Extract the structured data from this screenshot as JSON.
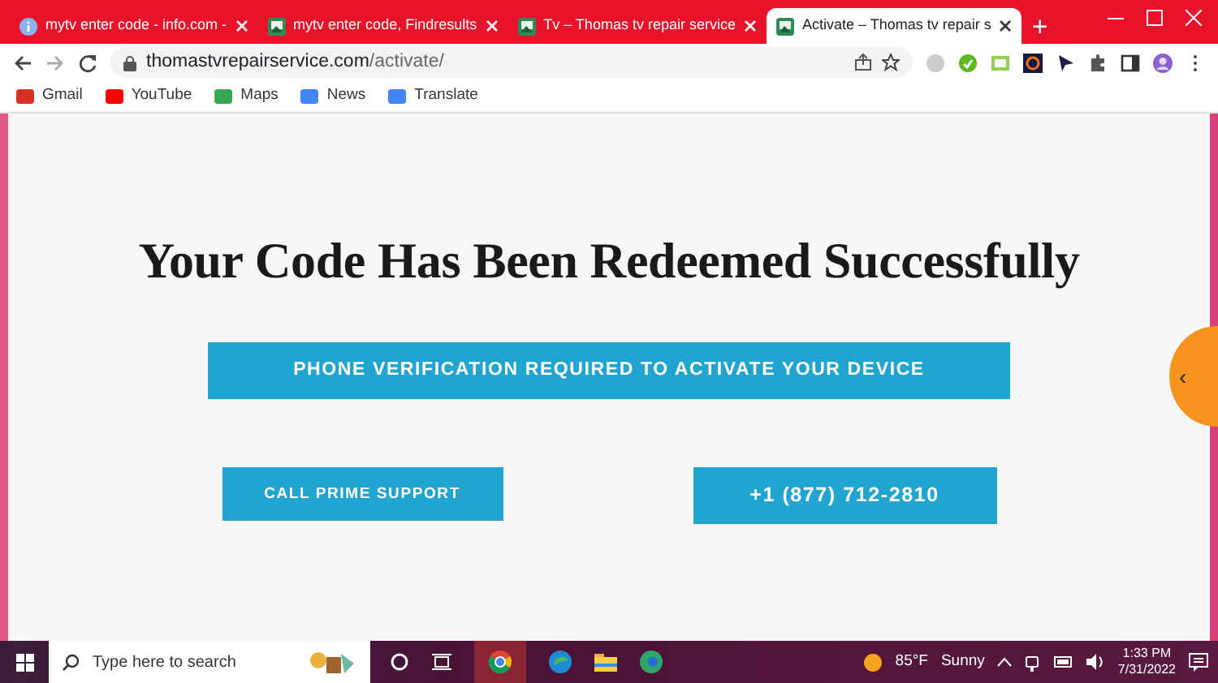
{
  "tabs": [
    {
      "title": "mytv enter code - info.com -",
      "selected": false
    },
    {
      "title": "mytv enter code, Findresults",
      "selected": false
    },
    {
      "title": "Tv – Thomas tv repair service",
      "selected": false
    },
    {
      "title": "Activate – Thomas tv repair s",
      "selected": true
    }
  ],
  "new_tab": "+",
  "address": {
    "host": "thomastvrepairservice.com",
    "path": "/activate/"
  },
  "bookmarks": [
    {
      "label": "Gmail",
      "color": "#d93025"
    },
    {
      "label": "YouTube",
      "color": "#ff0000"
    },
    {
      "label": "Maps",
      "color": "#34a853"
    },
    {
      "label": "News",
      "color": "#4285f4"
    },
    {
      "label": "Translate",
      "color": "#4285f4"
    }
  ],
  "page": {
    "heading": "Your Code Has Been Redeemed Successfully",
    "verify_button": "PHONE VERIFICATION REQUIRED TO ACTIVATE YOUR DEVICE",
    "support_button": "CALL PRIME SUPPORT",
    "phone_button": "+1 (877) 712-2810",
    "side_tab": "‹"
  },
  "taskbar": {
    "search_placeholder": "Type here to search",
    "temperature": "85°F",
    "condition": "Sunny",
    "time": "1:33 PM",
    "date": "7/31/2022"
  }
}
